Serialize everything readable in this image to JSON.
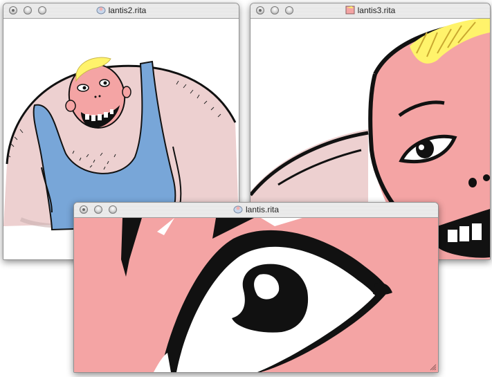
{
  "windows": [
    {
      "id": "lantis2",
      "title": "lantis2.rita"
    },
    {
      "id": "lantis3",
      "title": "lantis3.rita"
    },
    {
      "id": "lantis",
      "title": "lantis.rita"
    }
  ],
  "colors": {
    "skin": "#f4a4a4",
    "body_skin": "#edd0d0",
    "shirt": "#78a6d8",
    "hair": "#fff36b",
    "ink": "#000000"
  },
  "icons": [
    "close-icon",
    "minimize-icon",
    "zoom-icon",
    "document-proxy-icon",
    "resize-grip-icon"
  ]
}
